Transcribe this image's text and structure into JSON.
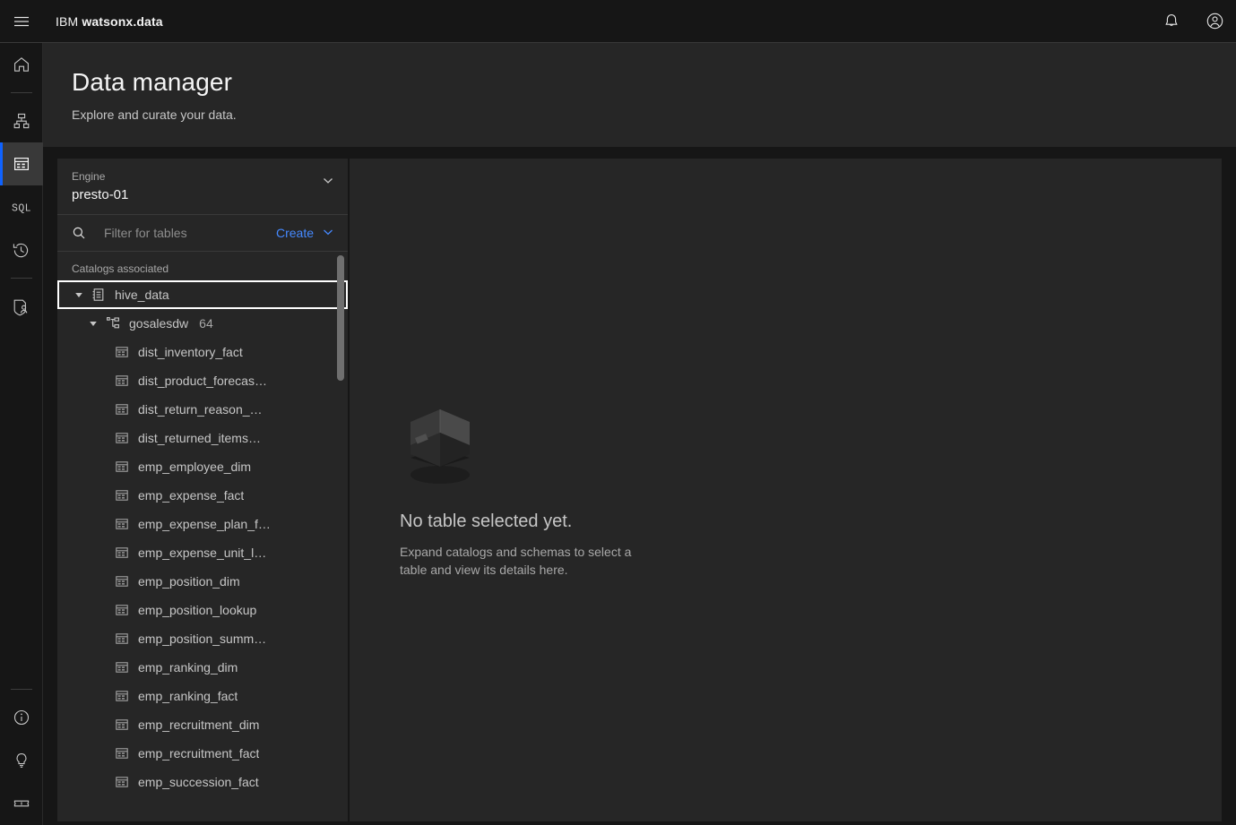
{
  "header": {
    "menu_icon": "hamburger-menu-icon",
    "brand_prefix": "IBM",
    "brand_name": "watsonx.data",
    "notification_icon": "bell-icon",
    "account_icon": "user-avatar-icon"
  },
  "rail": {
    "items": [
      {
        "name": "home",
        "icon": "home-icon",
        "active": false
      },
      {
        "name": "infrastructure",
        "icon": "infrastructure-icon",
        "active": false
      },
      {
        "name": "data-manager",
        "icon": "data-manager-icon",
        "active": true
      },
      {
        "name": "query-workspace",
        "icon": "sql-icon",
        "active": false
      },
      {
        "name": "query-history",
        "icon": "history-icon",
        "active": false
      },
      {
        "name": "access-control",
        "icon": "access-control-icon",
        "active": false
      }
    ],
    "bottom_items": [
      {
        "name": "about",
        "icon": "information-icon"
      },
      {
        "name": "tips",
        "icon": "lightbulb-icon"
      },
      {
        "name": "whats-new",
        "icon": "ticket-icon"
      }
    ]
  },
  "page": {
    "title": "Data manager",
    "subtitle": "Explore and curate your data."
  },
  "engine": {
    "label": "Engine",
    "value": "presto-01",
    "chevron_icon": "chevron-down-icon"
  },
  "filter": {
    "search_icon": "search-icon",
    "placeholder": "Filter for tables",
    "value": "",
    "create_label": "Create",
    "create_chevron_icon": "chevron-down-icon"
  },
  "tree": {
    "caption": "Catalogs associated",
    "catalog": {
      "label": "hive_data",
      "icon": "catalog-icon",
      "expanded": true,
      "focused": true
    },
    "schema": {
      "label": "gosalesdw",
      "icon": "schema-icon",
      "count": "64",
      "expanded": true
    },
    "tables": [
      {
        "label": "dist_inventory_fact",
        "icon": "table-icon"
      },
      {
        "label": "dist_product_forecas…",
        "icon": "table-icon"
      },
      {
        "label": "dist_return_reason_…",
        "icon": "table-icon"
      },
      {
        "label": "dist_returned_items…",
        "icon": "table-icon"
      },
      {
        "label": "emp_employee_dim",
        "icon": "table-icon"
      },
      {
        "label": "emp_expense_fact",
        "icon": "table-icon"
      },
      {
        "label": "emp_expense_plan_f…",
        "icon": "table-icon"
      },
      {
        "label": "emp_expense_unit_l…",
        "icon": "table-icon"
      },
      {
        "label": "emp_position_dim",
        "icon": "table-icon"
      },
      {
        "label": "emp_position_lookup",
        "icon": "table-icon"
      },
      {
        "label": "emp_position_summ…",
        "icon": "table-icon"
      },
      {
        "label": "emp_ranking_dim",
        "icon": "table-icon"
      },
      {
        "label": "emp_ranking_fact",
        "icon": "table-icon"
      },
      {
        "label": "emp_recruitment_dim",
        "icon": "table-icon"
      },
      {
        "label": "emp_recruitment_fact",
        "icon": "table-icon"
      },
      {
        "label": "emp_succession_fact",
        "icon": "table-icon"
      }
    ]
  },
  "detail": {
    "illustration": "empty-box-illustration",
    "empty_title": "No table selected yet.",
    "empty_description": "Expand catalogs and schemas to select a table and view its details here."
  },
  "colors": {
    "accent_blue": "#0f62fe",
    "link_blue": "#4589ff",
    "page_bg": "#161616",
    "panel_bg": "#262626",
    "active_rail": "#393939"
  }
}
